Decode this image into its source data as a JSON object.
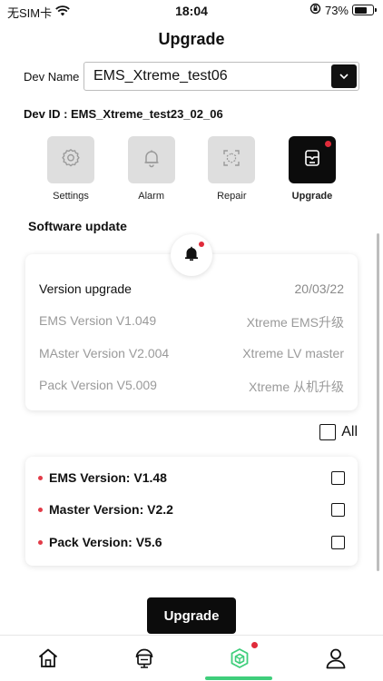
{
  "status_bar": {
    "carrier": "无SIM卡",
    "time": "18:04",
    "battery": "73%",
    "battery_level": 0.73
  },
  "page": {
    "title": "Upgrade"
  },
  "device": {
    "name_label": "Dev Name",
    "selected": "EMS_Xtreme_test06",
    "id_text": "Dev ID : EMS_Xtreme_test23_02_06"
  },
  "tabs": [
    {
      "label": "Settings",
      "icon": "gear-icon",
      "active": false
    },
    {
      "label": "Alarm",
      "icon": "bell-icon",
      "active": false
    },
    {
      "label": "Repair",
      "icon": "repair-icon",
      "active": false
    },
    {
      "label": "Upgrade",
      "icon": "upgrade-icon",
      "active": true,
      "badge": true
    }
  ],
  "software": {
    "title": "Software update",
    "header": {
      "label": "Version upgrade",
      "date": "20/03/22"
    },
    "versions": [
      {
        "label": "EMS Version V1.049",
        "desc": "Xtreme EMS升级"
      },
      {
        "label": "MAster Version V2.004",
        "desc": "Xtreme LV master"
      },
      {
        "label": "Pack Version V5.009",
        "desc": "Xtreme 从机升级"
      }
    ]
  },
  "select_all": {
    "label": "All"
  },
  "upgrades": [
    {
      "label": "EMS Version: V1.48"
    },
    {
      "label": "Master Version: V2.2"
    },
    {
      "label": "Pack Version: V5.6"
    }
  ],
  "actions": {
    "upgrade_label": "Upgrade"
  },
  "nav": [
    {
      "name": "home-icon"
    },
    {
      "name": "device-icon"
    },
    {
      "name": "upgrade-nav-icon",
      "active": true
    },
    {
      "name": "user-icon"
    }
  ],
  "colors": {
    "accent": "#3fce7b",
    "badge": "#e02b3a",
    "dark": "#0c0c0c"
  }
}
